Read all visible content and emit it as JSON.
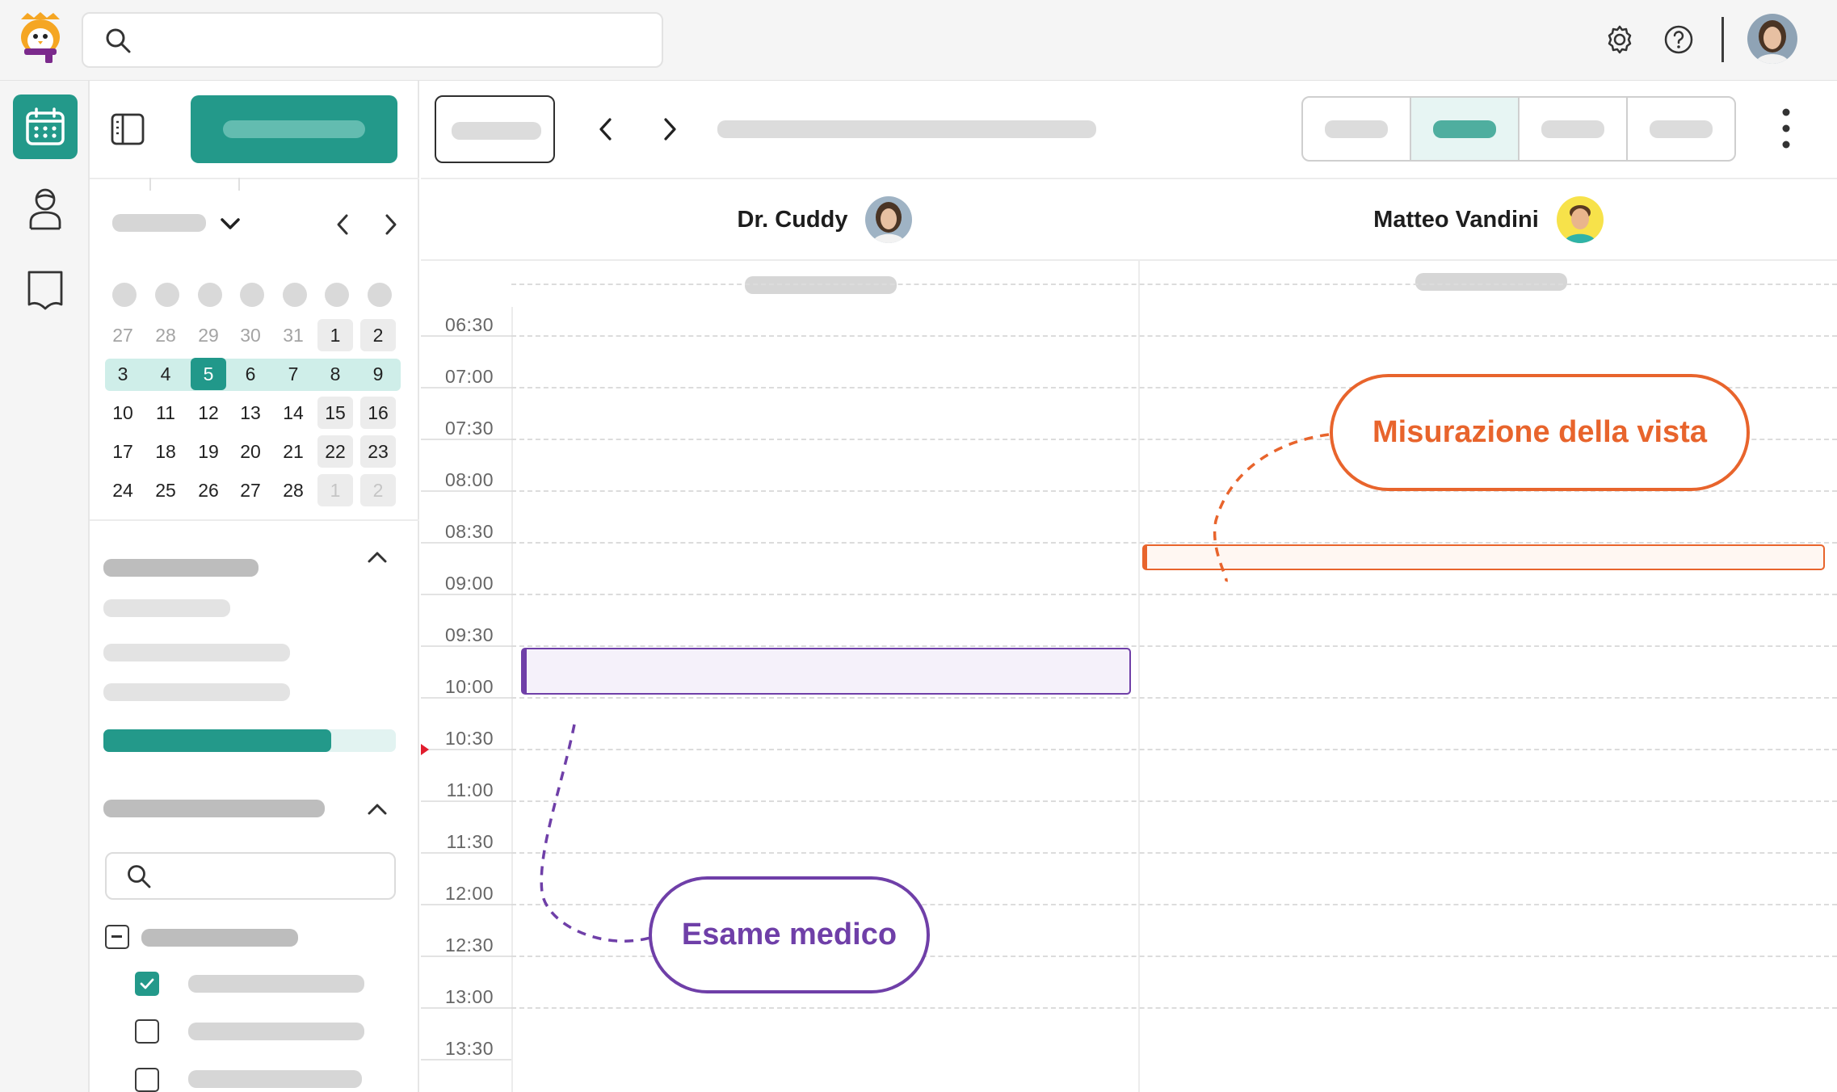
{
  "app": {
    "logo": "penguin-logo"
  },
  "topbar": {
    "search_placeholder": "",
    "icons": [
      "search-icon",
      "gear-icon",
      "help-icon"
    ],
    "avatar": "user-avatar"
  },
  "rail": {
    "items": [
      "calendar-icon",
      "patient-icon",
      "book-icon"
    ],
    "active": "calendar-icon"
  },
  "mini_calendar": {
    "rows": [
      [
        {
          "d": "27",
          "m": true
        },
        {
          "d": "28",
          "m": true
        },
        {
          "d": "29",
          "m": true
        },
        {
          "d": "30",
          "m": true
        },
        {
          "d": "31",
          "m": true
        },
        {
          "d": "1",
          "w": true
        },
        {
          "d": "2",
          "w": true
        }
      ],
      [
        {
          "d": "3"
        },
        {
          "d": "4"
        },
        {
          "d": "5",
          "sel": true
        },
        {
          "d": "6"
        },
        {
          "d": "7"
        },
        {
          "d": "8"
        },
        {
          "d": "9"
        }
      ],
      [
        {
          "d": "10"
        },
        {
          "d": "11"
        },
        {
          "d": "12"
        },
        {
          "d": "13"
        },
        {
          "d": "14"
        },
        {
          "d": "15",
          "w": true
        },
        {
          "d": "16",
          "w": true
        }
      ],
      [
        {
          "d": "17"
        },
        {
          "d": "18"
        },
        {
          "d": "19"
        },
        {
          "d": "20"
        },
        {
          "d": "21"
        },
        {
          "d": "22",
          "w": true
        },
        {
          "d": "23",
          "w": true
        }
      ],
      [
        {
          "d": "24"
        },
        {
          "d": "25"
        },
        {
          "d": "26"
        },
        {
          "d": "27"
        },
        {
          "d": "28"
        },
        {
          "d": "1",
          "w": true,
          "m": true
        },
        {
          "d": "2",
          "w": true,
          "m": true
        }
      ]
    ]
  },
  "sidebar": {
    "progress": 0.78,
    "checkboxes": [
      {
        "state": "indeterminate"
      },
      {
        "state": "checked"
      },
      {
        "state": "unchecked"
      },
      {
        "state": "unchecked"
      }
    ]
  },
  "toolbar": {
    "view_segments": 4,
    "active_segment": 1
  },
  "columns": [
    {
      "name": "Dr. Cuddy",
      "avatar": "female-doctor-avatar"
    },
    {
      "name": "Matteo Vandini",
      "avatar": "male-doctor-avatar"
    }
  ],
  "times": [
    "06:30",
    "07:00",
    "07:30",
    "08:00",
    "08:30",
    "09:00",
    "09:30",
    "10:00",
    "10:30",
    "11:00",
    "11:30",
    "12:00",
    "12:30",
    "13:00",
    "13:30"
  ],
  "current_time_marker": "10:30",
  "events": [
    {
      "column": 0,
      "start": "10:00",
      "end": "10:30",
      "color": "#6f3fa8",
      "fill": "#f5f1fa"
    },
    {
      "column": 1,
      "start": "09:00",
      "end": "09:15",
      "color": "#e8642c",
      "fill": "#fff7f2"
    }
  ],
  "callouts": {
    "eye": {
      "label": "Misurazione della vista",
      "color": "#e8642c"
    },
    "exam": {
      "label": "Esame medico",
      "color": "#6f3fa8"
    }
  }
}
